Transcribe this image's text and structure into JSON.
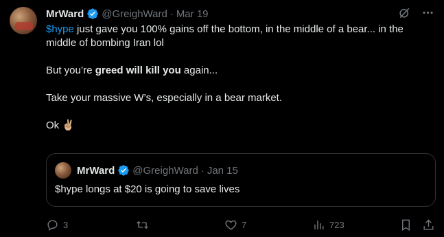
{
  "tweet": {
    "author_name": "MrWard",
    "handle": "@GreighWard",
    "separator": "·",
    "date": "Mar 19",
    "body": {
      "p1_hashtag": "$hype",
      "p1_rest": " just gave you 100% gains off the bottom, in the middle of a bear... in the middle of bombing Iran lol",
      "p2_prefix": "But you’re ",
      "p2_bold": "greed will kill you",
      "p2_suffix": " again...",
      "p3": "Take your massive W’s, especially in a bear market.",
      "p4_text": "Ok",
      "p4_emoji": "✌🏼"
    }
  },
  "quote": {
    "author_name": "MrWard",
    "handle": "@GreighWard",
    "separator": "·",
    "date": "Jan 15",
    "text": "$hype longs at $20 is going to save lives"
  },
  "actions": {
    "replies": "3",
    "retweets": "",
    "likes": "7",
    "views": "723"
  },
  "colors": {
    "background": "#000000",
    "text": "#e7e9ea",
    "muted": "#71767b",
    "accent": "#1d9bf0",
    "border": "#2f3336"
  }
}
